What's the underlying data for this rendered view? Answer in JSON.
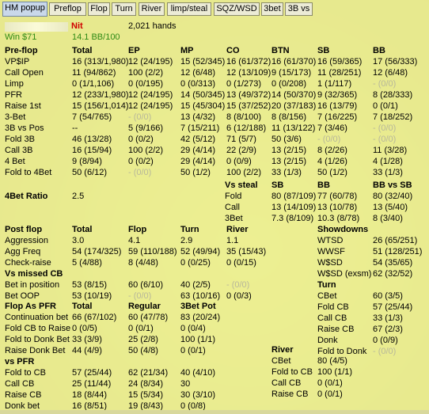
{
  "tabs": [
    {
      "label": "HM popup",
      "active": true
    },
    {
      "label": "Preflop"
    },
    {
      "label": "Flop"
    },
    {
      "label": "Turn"
    },
    {
      "label": "River"
    },
    {
      "label": "limp/steal"
    },
    {
      "label": "SQZ/WSD"
    },
    {
      "label": "3bet"
    },
    {
      "label": "3B vs"
    }
  ],
  "player": {
    "type": "Nit",
    "hands": "2,021 hands",
    "win": "Win $71",
    "bb_rate": "14.1 BB/100"
  },
  "preflop": {
    "title": "Pre-flop",
    "headers": [
      "Total",
      "EP",
      "MP",
      "CO",
      "BTN",
      "SB",
      "BB"
    ],
    "rows": [
      {
        "label": "VP$IP",
        "cells": [
          "16 (313/1,980)",
          "12 (24/195)",
          "15 (52/345)",
          "16 (61/372)",
          "16 (61/370)",
          "16 (59/365)",
          "17 (56/333)"
        ],
        "dim": []
      },
      {
        "label": "Call Open",
        "cells": [
          "11 (94/862)",
          "100 (2/2)",
          "12 (6/48)",
          "12 (13/109)",
          "9 (15/173)",
          "11 (28/251)",
          "12 (6/48)"
        ],
        "dim": []
      },
      {
        "label": "Limp",
        "cells": [
          "0 (1/1,106)",
          "0 (0/195)",
          "0 (0/313)",
          "0 (1/273)",
          "0 (0/208)",
          "1 (1/117)",
          "- (0/0)"
        ],
        "dim": [
          6
        ]
      },
      {
        "label": "PFR",
        "cells": [
          "12 (233/1,980)",
          "12 (24/195)",
          "14 (50/345)",
          "13 (49/372)",
          "14 (50/370)",
          "9 (32/365)",
          "8 (28/333)"
        ],
        "dim": []
      },
      {
        "label": "Raise 1st",
        "cells": [
          "15 (156/1,014)",
          "12 (24/195)",
          "15 (45/304)",
          "15 (37/252)",
          "20 (37/183)",
          "16 (13/79)",
          "0 (0/1)"
        ],
        "dim": []
      },
      {
        "label": "3-Bet",
        "cells": [
          "7 (54/765)",
          "- (0/0)",
          "13 (4/32)",
          "8 (8/100)",
          "8 (8/156)",
          "7 (16/225)",
          "7 (18/252)"
        ],
        "dim": [
          1
        ]
      },
      {
        "label": "3B vs Pos",
        "cells": [
          "--",
          "5 (9/166)",
          "7 (15/211)",
          "6 (12/188)",
          "11 (13/122)",
          "7 (3/46)",
          "- (0/0)"
        ],
        "dim": [
          6
        ]
      },
      {
        "label": "Fold 3B",
        "cells": [
          "46 (13/28)",
          "0 (0/2)",
          "42 (5/12)",
          "71 (5/7)",
          "50 (3/6)",
          "- (0/0)",
          "- (0/0)"
        ],
        "dim": [
          5,
          6
        ]
      },
      {
        "label": "Call 3B",
        "cells": [
          "16 (15/94)",
          "100 (2/2)",
          "29 (4/14)",
          "22 (2/9)",
          "13 (2/15)",
          "8 (2/26)",
          "11 (3/28)"
        ],
        "dim": []
      },
      {
        "label": "4 Bet",
        "cells": [
          "9 (8/94)",
          "0 (0/2)",
          "29 (4/14)",
          "0 (0/9)",
          "13 (2/15)",
          "4 (1/26)",
          "4 (1/28)"
        ],
        "dim": []
      },
      {
        "label": "Fold to 4Bet",
        "cells": [
          "50 (6/12)",
          "- (0/0)",
          "50 (1/2)",
          "100 (2/2)",
          "33 (1/3)",
          "50 (1/2)",
          "33 (1/3)"
        ],
        "dim": [
          1
        ]
      }
    ]
  },
  "steal": {
    "title": "Vs steal",
    "headers": [
      "SB",
      "BB",
      "BB vs SB"
    ],
    "rows": [
      {
        "label": "Fold",
        "cells": [
          "80 (87/109)",
          "77 (60/78)",
          "80 (32/40)"
        ]
      },
      {
        "label": "Call",
        "cells": [
          "13 (14/109)",
          "13 (10/78)",
          "13 (5/40)"
        ]
      },
      {
        "label": "3Bet",
        "cells": [
          "7.3 (8/109)",
          "10.3 (8/78)",
          "8 (3/40)"
        ]
      }
    ]
  },
  "ratio": {
    "label": "4Bet Ratio",
    "value": "2.5"
  },
  "postflop": {
    "title": "Post flop",
    "headers": [
      "Total",
      "Flop",
      "Turn",
      "River"
    ],
    "rows": [
      {
        "label": "Aggression",
        "cells": [
          "3.0",
          "4.1",
          "2.9",
          "1.1"
        ],
        "dim": []
      },
      {
        "label": "Agg Freq",
        "cells": [
          "54 (174/325)",
          "59 (110/188)",
          "52 (49/94)",
          "35 (15/43)"
        ],
        "dim": []
      },
      {
        "label": "Check-raise",
        "cells": [
          "5 (4/88)",
          "8 (4/48)",
          "0 (0/25)",
          "0 (0/15)"
        ],
        "dim": []
      }
    ]
  },
  "showdowns": {
    "title": "Showdowns",
    "rows": [
      {
        "label": "WTSD",
        "value": "26 (65/251)"
      },
      {
        "label": "WWSF",
        "value": "51 (128/251)"
      },
      {
        "label": "W$SD",
        "value": "54 (35/65)"
      },
      {
        "label": "W$SD (exsm)",
        "value": "62 (32/52)"
      }
    ]
  },
  "vs_missed_cb": {
    "title": "Vs missed CB",
    "rows": [
      {
        "label": "Bet in position",
        "cells": [
          "53 (8/15)",
          "60 (6/10)",
          "40 (2/5)",
          "- (0/0)"
        ],
        "dim": [
          3
        ]
      },
      {
        "label": "Bet OOP",
        "cells": [
          "53 (10/19)",
          "- (0/0)",
          "63 (10/16)",
          "0 (0/3)"
        ],
        "dim": [
          1
        ]
      }
    ]
  },
  "turn_stats": {
    "title": "Turn",
    "rows": [
      {
        "label": "CBet",
        "value": "60 (3/5)"
      },
      {
        "label": "Fold CB",
        "value": "57 (25/44)"
      },
      {
        "label": "Call CB",
        "value": "33 (1/3)"
      },
      {
        "label": "Raise CB",
        "value": "67 (2/3)"
      },
      {
        "label": "Donk",
        "value": "0 (0/9)"
      },
      {
        "label": "Fold to Donk",
        "value": "- (0/0)"
      }
    ]
  },
  "flop_as_pfr": {
    "title": "Flop As PFR",
    "headers": [
      "Total",
      "Regular",
      "3Bet Pot"
    ],
    "rows": [
      {
        "label": "Continuation bet",
        "cells": [
          "66 (67/102)",
          "60 (47/78)",
          "83 (20/24)"
        ],
        "dim": []
      },
      {
        "label": "Fold CB to Raise",
        "cells": [
          "0 (0/5)",
          "0 (0/1)",
          "0 (0/4)"
        ],
        "dim": []
      },
      {
        "label": "Fold to Donk Bet",
        "cells": [
          "33 (3/9)",
          "25 (2/8)",
          "100 (1/1)"
        ],
        "dim": []
      },
      {
        "label": "Raise Donk Bet",
        "cells": [
          "44 (4/9)",
          "50 (4/8)",
          "0 (0/1)"
        ],
        "dim": []
      }
    ]
  },
  "vs_pfr": {
    "title": "vs PFR",
    "rows": [
      {
        "label": "Fold to CB",
        "cells": [
          "57 (25/44)",
          "62 (21/34)",
          "40 (4/10)"
        ]
      },
      {
        "label": "Call CB",
        "cells": [
          "25 (11/44)",
          "24 (8/34)",
          "30"
        ]
      },
      {
        "label": "Raise CB",
        "cells": [
          "18 (8/44)",
          "15 (5/34)",
          "30 (3/10)"
        ]
      },
      {
        "label": "Donk bet",
        "cells": [
          "16 (8/51)",
          "19 (8/43)",
          "0 (0/8)"
        ]
      }
    ]
  },
  "river_stats": {
    "title": "River",
    "rows": [
      {
        "label": "CBet",
        "value": "80 (4/5)"
      },
      {
        "label": "Fold to CB",
        "value": "100 (1/1)"
      },
      {
        "label": "Call CB",
        "value": "0 (0/1)"
      },
      {
        "label": "Raise CB",
        "value": "0 (0/1)"
      }
    ]
  },
  "colors": {
    "panel": "#f6f696",
    "accent_red": "#d00000",
    "accent_green": "#2e8a14",
    "dim_text": "#b7b79a",
    "tab_active": "#c9d8ea"
  }
}
